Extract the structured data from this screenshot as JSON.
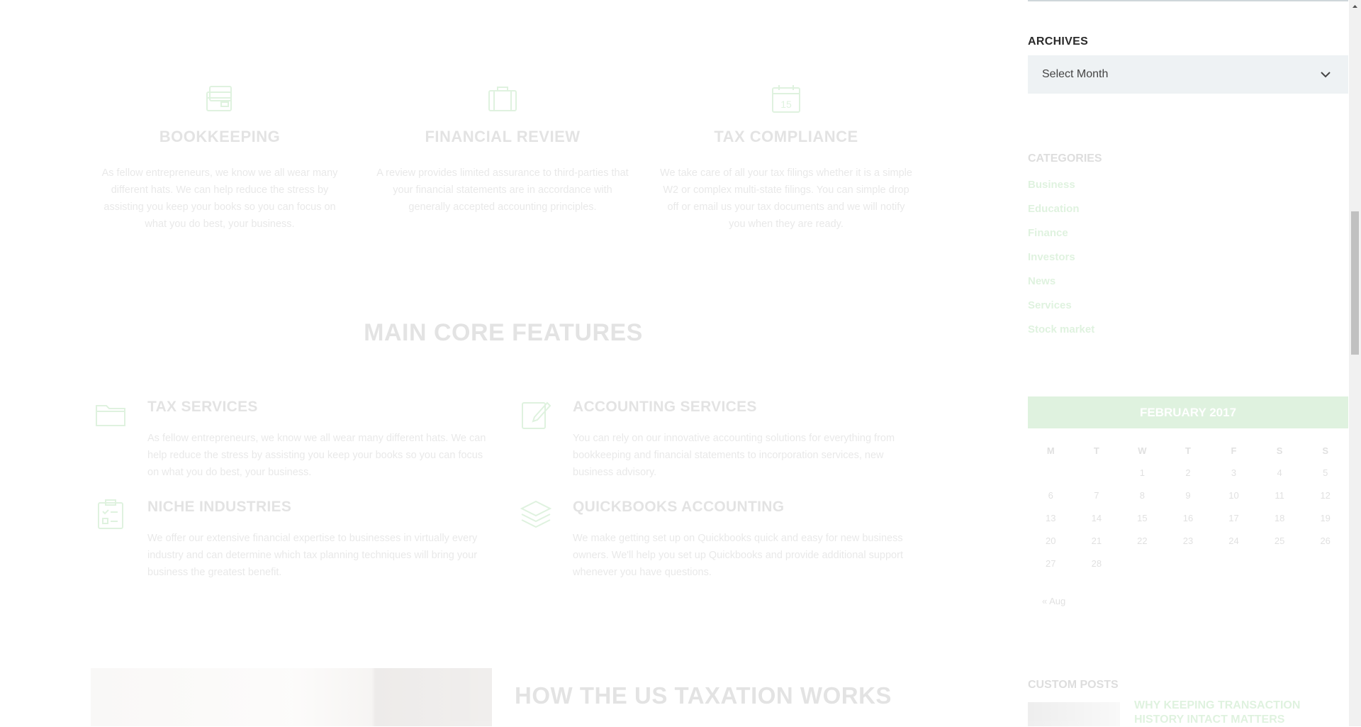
{
  "services": [
    {
      "title": "BOOKKEEPING",
      "icon": "wallet-cards-icon",
      "text": "As fellow entrepreneurs, we know we all wear many different hats. We can help reduce the stress by assisting you keep your books so you can focus on what you do best, your business."
    },
    {
      "title": "FINANCIAL REVIEW",
      "icon": "briefcase-icon",
      "text": "A review provides limited assurance to third-parties that your financial statements are in accordance with generally accepted accounting principles."
    },
    {
      "title": "TAX COMPLIANCE",
      "icon": "calendar-15-icon",
      "text": "We take care of all your tax filings whether it is a simple W2 or complex multi-state filings. You can simple drop off or email us your tax documents and we will notify you when they are ready."
    }
  ],
  "core": {
    "title": "MAIN CORE FEATURES",
    "features": [
      {
        "title": "TAX SERVICES",
        "icon": "folder-icon",
        "text": "As fellow entrepreneurs, we know we all wear many different hats. We can help reduce the stress by assisting you keep your books so you can focus on what you do best, your business."
      },
      {
        "title": "ACCOUNTING SERVICES",
        "icon": "edit-document-icon",
        "text": "You can rely on our innovative accounting solutions for everything from bookkeeping and financial statements to incorporation services, new business advisory."
      },
      {
        "title": "NICHE INDUSTRIES",
        "icon": "clipboard-checklist-icon",
        "text": "We offer our extensive financial expertise to businesses in virtually every industry and can determine which tax planning techniques will bring your business the greatest benefit."
      },
      {
        "title": "QUICKBOOKS ACCOUNTING",
        "icon": "layers-stack-icon",
        "text": "We make getting set up on Quickbooks quick and easy for new business owners. We'll help you set up Quickbooks and provide additional support whenever you have questions."
      }
    ]
  },
  "taxation": {
    "title": "HOW THE US TAXATION WORKS"
  },
  "sidebar": {
    "archives_title": "ARCHIVES",
    "archives_select": "Select Month",
    "categories_title": "CATEGORIES",
    "categories": [
      "Business",
      "Education",
      "Finance",
      "Investors",
      "News",
      "Services",
      "Stock market"
    ],
    "calendar": {
      "caption": "FEBRUARY 2017",
      "days": [
        "M",
        "T",
        "W",
        "T",
        "F",
        "S",
        "S"
      ],
      "weeks": [
        [
          "",
          "",
          "1",
          "2",
          "3",
          "4",
          "5"
        ],
        [
          "6",
          "7",
          "8",
          "9",
          "10",
          "11",
          "12"
        ],
        [
          "13",
          "14",
          "15",
          "16",
          "17",
          "18",
          "19"
        ],
        [
          "20",
          "21",
          "22",
          "23",
          "24",
          "25",
          "26"
        ],
        [
          "27",
          "28",
          "",
          "",
          "",
          "",
          ""
        ]
      ],
      "prev": "« Aug"
    },
    "custom_posts_title": "CUSTOM POSTS",
    "custom_post_link": "WHY KEEPING TRANSACTION HISTORY INTACT MATTERS"
  },
  "colors": {
    "accent": "#3db53d",
    "select_bg": "#eef2f4"
  }
}
